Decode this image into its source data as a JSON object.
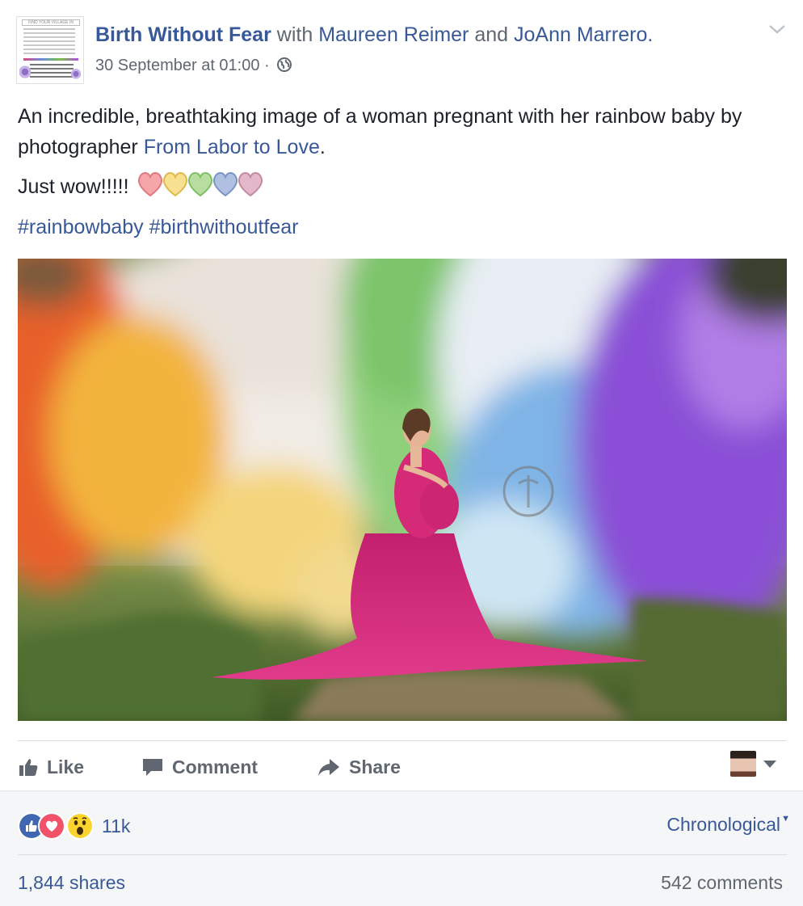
{
  "post": {
    "page_name": "Birth Without Fear",
    "with_word": "with",
    "tagged_1": "Maureen Reimer",
    "and_word": "and",
    "tagged_2": "JoAnn Marrero.",
    "timestamp": "30 September at 01:00",
    "meta_sep": "·",
    "privacy_icon": "globe-icon",
    "text_line_1_a": "An incredible, breathtaking image of a woman pregnant with her rainbow baby by photographer ",
    "text_link": "From Labor to Love",
    "text_line_1_b": ".",
    "text_line_2": "Just wow!!!!!",
    "hearts": [
      "#f4a6a9",
      "#f7e08f",
      "#b7dea0",
      "#b0c0e0",
      "#e3b8c9"
    ],
    "hashtag_1": "#rainbowbaby",
    "hashtag_2": "#birthwithoutfear"
  },
  "avatar_text": {
    "header": "FIND YOUR VILLAGE IN"
  },
  "actions": {
    "like": "Like",
    "comment": "Comment",
    "share": "Share"
  },
  "footer": {
    "reaction_icons": [
      "like-reaction-icon",
      "love-reaction-icon",
      "wow-reaction-icon"
    ],
    "reaction_count": "11k",
    "sort_label": "Chronological",
    "shares": "1,844 shares",
    "comments": "542 comments"
  },
  "colors": {
    "link": "#385898",
    "like_blue": "#4267b2",
    "love_red": "#f25268",
    "wow_yellow": "#fcd22d",
    "dress_pink": "#d4237a"
  }
}
